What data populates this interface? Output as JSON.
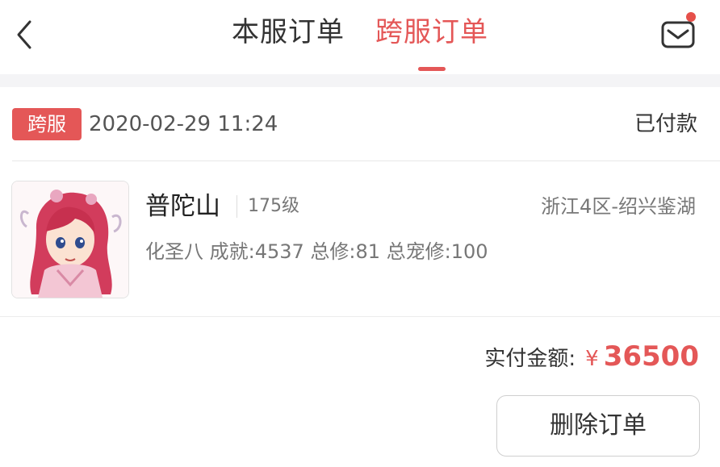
{
  "header": {
    "back_icon": "chevron-left-icon",
    "tabs": [
      {
        "label": "本服订单",
        "active": false
      },
      {
        "label": "跨服订单",
        "active": true
      }
    ],
    "mail_icon": "mail-icon",
    "accent_color": "#e45757"
  },
  "order": {
    "badge": "跨服",
    "time": "2020-02-29 11:24",
    "status": "已付款",
    "item": {
      "avatar_icon": "character-portrait",
      "name": "普陀山",
      "level": "175级",
      "server": "浙江4区-绍兴鉴湖",
      "stats": "化圣八 成就:4537 总修:81 总宠修:100"
    },
    "total": {
      "label": "实付金额:",
      "currency": "¥",
      "amount": "36500"
    },
    "delete_button": "删除订单"
  }
}
